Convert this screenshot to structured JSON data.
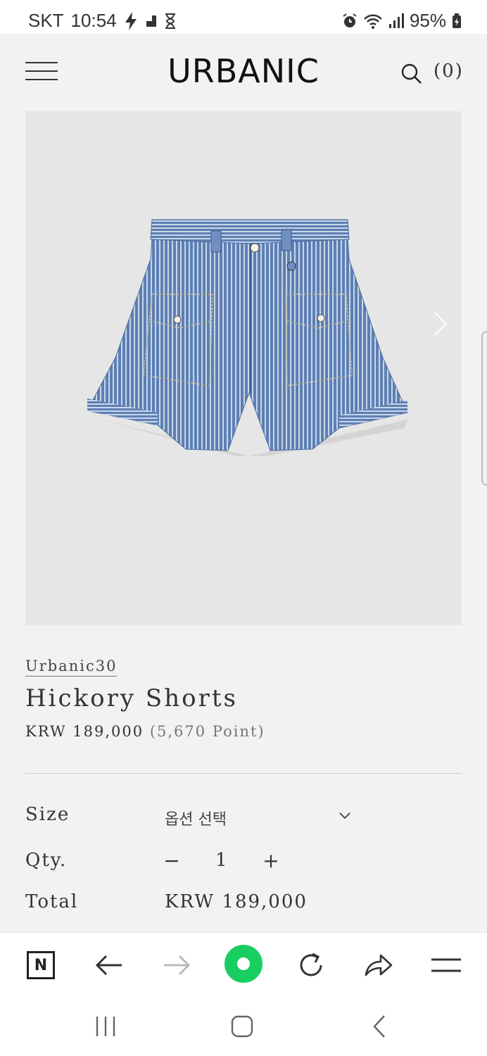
{
  "status": {
    "carrier": "SKT",
    "time": "10:54",
    "battery": "95%"
  },
  "header": {
    "logo": "URBANIC",
    "cart": "(0)"
  },
  "product": {
    "brand": "Urbanic30",
    "title": "Hickory Shorts",
    "price": "KRW 189,000",
    "points": "(5,670 Point)"
  },
  "options": {
    "size_label": "Size",
    "size_value": "옵션 선택",
    "qty_label": "Qty.",
    "qty_minus": "−",
    "qty_value": "1",
    "qty_plus": "+",
    "total_label": "Total",
    "total_value": "KRW 189,000"
  },
  "toolbar": {
    "n_label": "N"
  },
  "colors": {
    "accent_green": "#19ce60",
    "background": "#f2f2f2",
    "image_bg": "#e6e6e6"
  }
}
